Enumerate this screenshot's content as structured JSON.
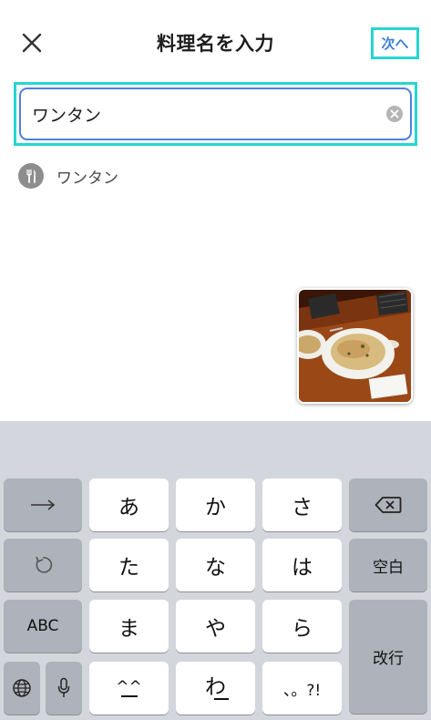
{
  "header": {
    "title": "料理名を入力",
    "next_label": "次へ"
  },
  "search": {
    "value": "ワンタン"
  },
  "suggestions": [
    {
      "label": "ワンタン"
    }
  ],
  "keyboard": {
    "rows": [
      [
        "→",
        "あ",
        "か",
        "さ",
        "⌫"
      ],
      [
        "↺",
        "た",
        "な",
        "は",
        "空白"
      ],
      [
        "ABC",
        "ま",
        "や",
        "ら",
        "改行"
      ],
      [
        "🌐",
        "🎤",
        "^^",
        "わ",
        "、。?!"
      ]
    ],
    "keys": {
      "a": "あ",
      "ka": "か",
      "sa": "さ",
      "ta": "た",
      "na": "な",
      "ha": "は",
      "ma": "ま",
      "ya": "や",
      "ra": "ら",
      "emoji": "^^",
      "wa": "わ",
      "punct": "、。?!",
      "abc": "ABC",
      "space": "空白",
      "return": "改行"
    }
  }
}
